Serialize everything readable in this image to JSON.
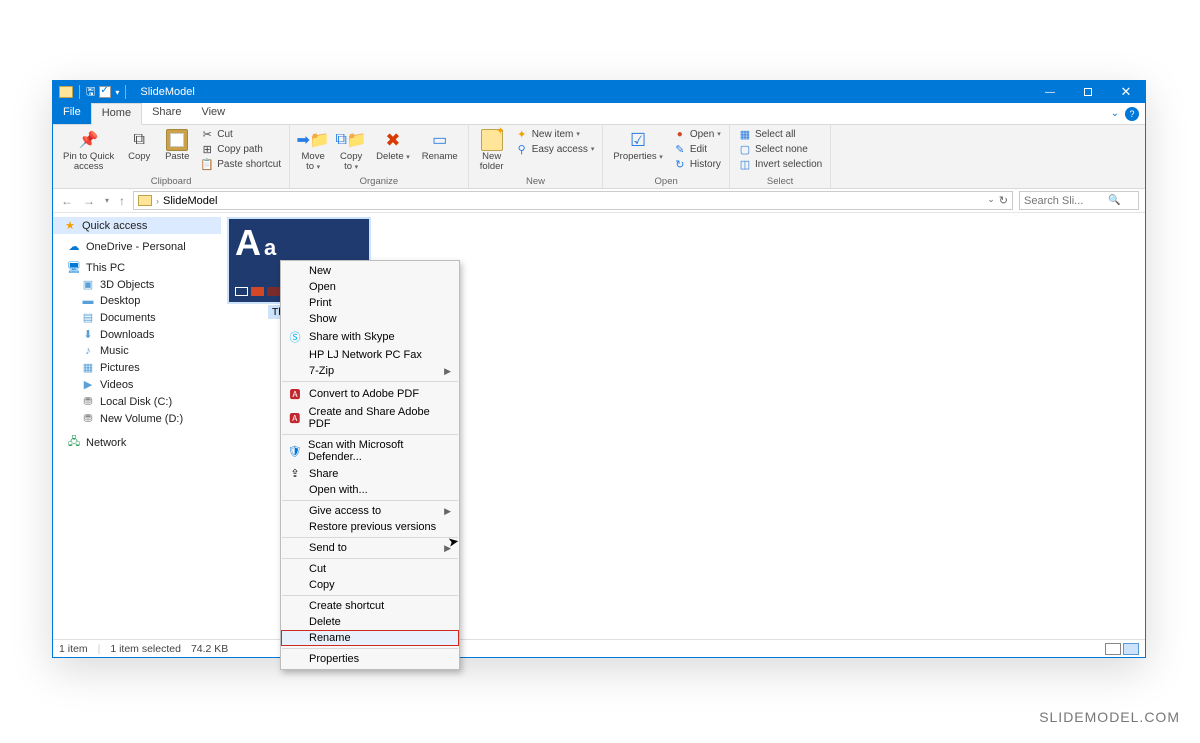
{
  "window": {
    "title": "SlideModel"
  },
  "tabs": {
    "file": "File",
    "home": "Home",
    "share": "Share",
    "view": "View"
  },
  "ribbon": {
    "clipboard": {
      "label": "Clipboard",
      "pin": "Pin to Quick\naccess",
      "copy": "Copy",
      "paste": "Paste",
      "cut": "Cut",
      "copypath": "Copy path",
      "pasteshort": "Paste shortcut"
    },
    "organize": {
      "label": "Organize",
      "move": "Move\nto",
      "copyto": "Copy\nto",
      "delete": "Delete",
      "rename": "Rename"
    },
    "new": {
      "label": "New",
      "newfolder": "New\nfolder",
      "newitem": "New item",
      "easyaccess": "Easy access"
    },
    "open": {
      "label": "Open",
      "props": "Properties",
      "open": "Open",
      "edit": "Edit",
      "history": "History"
    },
    "select": {
      "label": "Select",
      "all": "Select all",
      "none": "Select none",
      "inv": "Invert selection"
    }
  },
  "address": {
    "crumb": "SlideModel"
  },
  "search": {
    "placeholder": "Search Sli..."
  },
  "sidebar": {
    "quick": "Quick access",
    "onedrive": "OneDrive - Personal",
    "thispc": "This PC",
    "items": [
      "3D Objects",
      "Desktop",
      "Documents",
      "Downloads",
      "Music",
      "Pictures",
      "Videos",
      "Local Disk (C:)",
      "New Volume (D:)"
    ],
    "network": "Network"
  },
  "file": {
    "name": "Theme1.thmx"
  },
  "context": {
    "new": "New",
    "open": "Open",
    "print": "Print",
    "show": "Show",
    "skype": "Share with Skype",
    "fax": "HP LJ Network PC Fax",
    "zip": "7-Zip",
    "pdf1": "Convert to Adobe PDF",
    "pdf2": "Create and Share Adobe PDF",
    "defender": "Scan with Microsoft Defender...",
    "share": "Share",
    "openwith": "Open with...",
    "access": "Give access to",
    "restore": "Restore previous versions",
    "sendto": "Send to",
    "cut": "Cut",
    "copy": "Copy",
    "shortcut": "Create shortcut",
    "delete": "Delete",
    "rename": "Rename",
    "props": "Properties"
  },
  "status": {
    "count": "1 item",
    "sel": "1 item selected",
    "size": "74.2 KB"
  },
  "watermark": "SLIDEMODEL.COM"
}
